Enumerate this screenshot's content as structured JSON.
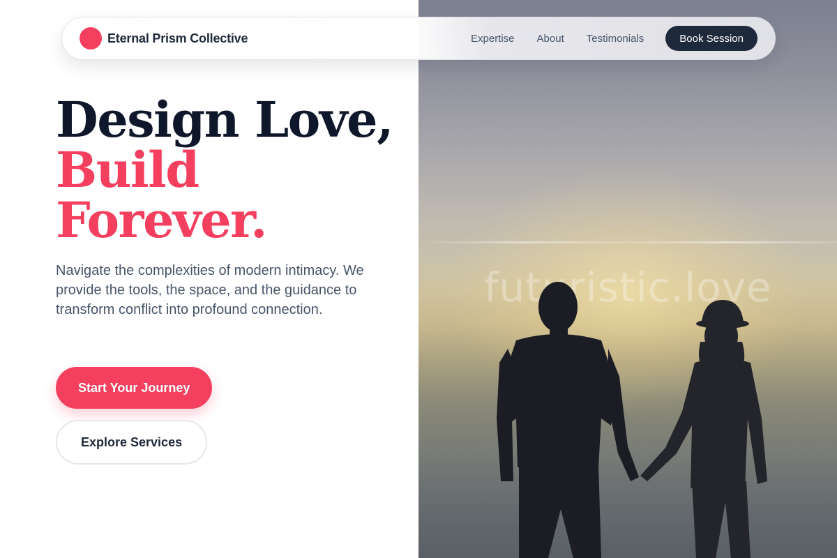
{
  "nav": {
    "brand": "Eternal Prism Collective",
    "links": [
      "Expertise",
      "About",
      "Testimonials"
    ],
    "cta": "Book Session"
  },
  "hero": {
    "headline_line1": "Design Love,",
    "headline_line2": "Build",
    "headline_line3": "Forever.",
    "description": "Navigate the complexities of modern intimacy. We provide the tools, the space, and the guidance to transform conflict into profound connection.",
    "primary_cta": "Start Your Journey",
    "secondary_cta": "Explore Services",
    "image_watermark": "futuristic.love"
  },
  "colors": {
    "accent": "#f43f5e",
    "dark": "#1e293b",
    "text_muted": "#475569"
  }
}
